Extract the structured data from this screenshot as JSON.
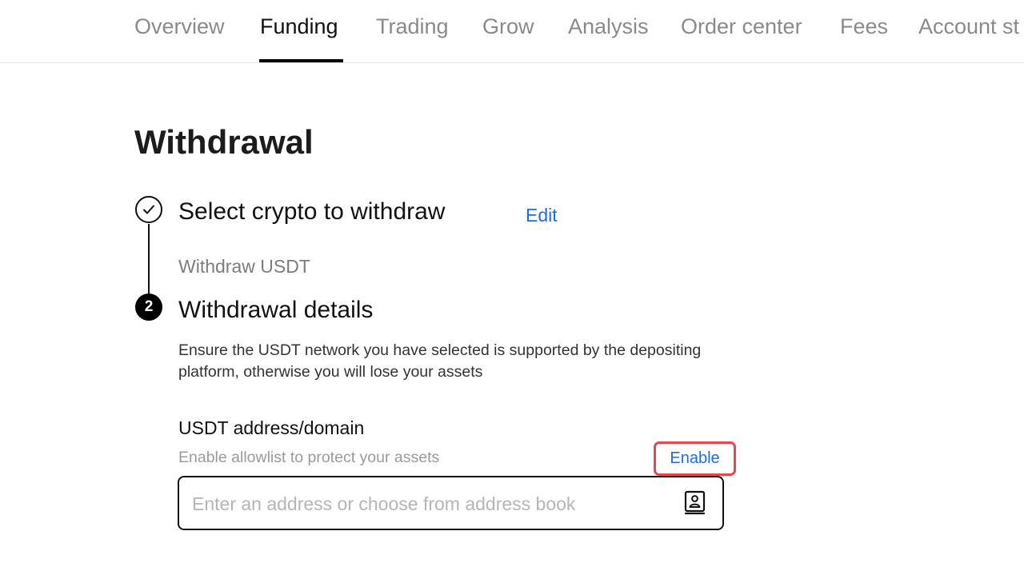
{
  "nav": {
    "items": [
      {
        "label": "Overview"
      },
      {
        "label": "Funding",
        "active": true
      },
      {
        "label": "Trading"
      },
      {
        "label": "Grow"
      },
      {
        "label": "Analysis"
      },
      {
        "label": "Order center"
      },
      {
        "label": "Fees"
      },
      {
        "label": "Account st"
      }
    ]
  },
  "page": {
    "title": "Withdrawal"
  },
  "steps": [
    {
      "status": "completed",
      "title": "Select crypto to withdraw",
      "action": "Edit",
      "summary": "Withdraw USDT"
    },
    {
      "number": "2",
      "status": "current",
      "title": "Withdrawal details",
      "notice": "Ensure the USDT network you have selected is supported by the depositing platform, otherwise you will lose your assets"
    }
  ],
  "address": {
    "label": "USDT address/domain",
    "hint": "Enable allowlist to protect your assets",
    "enable_label": "Enable",
    "placeholder": "Enter an address or choose from address book",
    "value": "",
    "icon": "address-book-icon"
  },
  "colors": {
    "link": "#1a6ee8",
    "highlight": "#e5484d"
  }
}
